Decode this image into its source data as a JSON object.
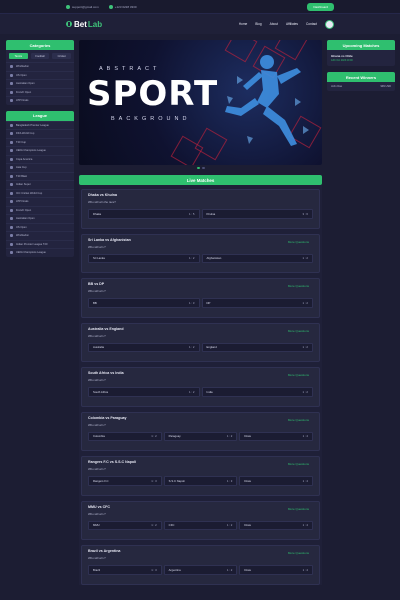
{
  "topbar": {
    "email": "support@gmail.com",
    "phone": "+123 0228 3330",
    "dashboard_label": "Dashboard"
  },
  "nav": {
    "brand_a": "Bet",
    "brand_b": "Lab",
    "menu": [
      "Home",
      "Blog",
      "About",
      "Affiliates",
      "Contact"
    ]
  },
  "categories": {
    "title": "Categories",
    "tabs": [
      "Tennis",
      "Football",
      "Cricket"
    ],
    "items": [
      "Wimbledon",
      "US Open",
      "Australian Open",
      "French Open",
      "ATP Finals"
    ]
  },
  "league": {
    "title": "League",
    "items": [
      "Bangladesh Premier League",
      "FIFA World Cup",
      "T20 Cup",
      "UEFA Champions League",
      "Copa America",
      "Asia Cup",
      "T20 Blast",
      "Indian Super",
      "ICC Cricket World Cup",
      "ATP Finals",
      "French Open",
      "Australian Open",
      "US Open",
      "Wimbledon",
      "Indian Premier League T20",
      "UEFA Champions League"
    ]
  },
  "hero": {
    "top_text": "ABSTRACT",
    "main_text": "SPORT",
    "bottom_text": "BACKGROUND"
  },
  "live": {
    "title": "Live Matches",
    "more_label": "More Questions",
    "matches": [
      {
        "title": "Dhaka vs Khulna",
        "question": "Who will win the race?",
        "odds": [
          {
            "team": "Dhaka",
            "val": "1 : 5"
          },
          {
            "team": "Khulna",
            "val": "3 : 6"
          }
        ],
        "more": false
      },
      {
        "title": "Sri Lanka vs Afghanistan",
        "question": "Who will win ?",
        "odds": [
          {
            "team": "Sri Lanka",
            "val": "1 : 2"
          },
          {
            "team": "Afghanistan",
            "val": "1 : 2"
          }
        ],
        "more": true
      },
      {
        "title": "BB vs DP",
        "question": "Who will win ?",
        "odds": [
          {
            "team": "BB",
            "val": "1 : 3"
          },
          {
            "team": "DP",
            "val": "1 : 2"
          }
        ],
        "more": true
      },
      {
        "title": "Australia vs England",
        "question": "Who will win ?",
        "odds": [
          {
            "team": "Australia",
            "val": "1 : 2"
          },
          {
            "team": "England",
            "val": "1 : 2"
          }
        ],
        "more": true
      },
      {
        "title": "South Africa vs India",
        "question": "Who will win ?",
        "odds": [
          {
            "team": "South Africa",
            "val": "1 : 2"
          },
          {
            "team": "India",
            "val": "1 : 2"
          }
        ],
        "more": true
      },
      {
        "title": "Colombia vs Paraguay",
        "question": "Who will win ?",
        "odds": [
          {
            "team": "Colombia",
            "val": "1 : 2"
          },
          {
            "team": "Paraguay",
            "val": "1 : 2"
          },
          {
            "team": "Draw",
            "val": "1 : 2"
          }
        ],
        "more": true
      },
      {
        "title": "Rangers F.C vs S.S.C Napoli",
        "question": "Who will win ?",
        "odds": [
          {
            "team": "Rangers F.C",
            "val": "1 : 3"
          },
          {
            "team": "S.S.C Napoli",
            "val": "1 : 3"
          },
          {
            "team": "Draw",
            "val": "1 : 2"
          }
        ],
        "more": true
      },
      {
        "title": "MMU vs CFC",
        "question": "Who will win ?",
        "odds": [
          {
            "team": "MMU",
            "val": "1 : 2"
          },
          {
            "team": "CFC",
            "val": "1 : 2"
          },
          {
            "team": "Draw",
            "val": "1 : 2"
          }
        ],
        "more": true
      },
      {
        "title": "Brazil vs Argentina",
        "question": "Who will win ?",
        "odds": [
          {
            "team": "Brazil",
            "val": "1 : 3"
          },
          {
            "team": "Argentina",
            "val": "1 : 2"
          },
          {
            "team": "Draw",
            "val": "1 : 2"
          }
        ],
        "more": true
      }
    ]
  },
  "upcoming": {
    "title": "Upcoming Matches",
    "match": "Ghana vs Chile",
    "time": "12th Oct 2023 20:00"
  },
  "winners": {
    "title": "Recent Winners",
    "name": "John Doe",
    "amount": "999 USD"
  },
  "colors": {
    "accent": "#2fbf6f",
    "background": "#1c1d33",
    "panel": "#23243f"
  }
}
